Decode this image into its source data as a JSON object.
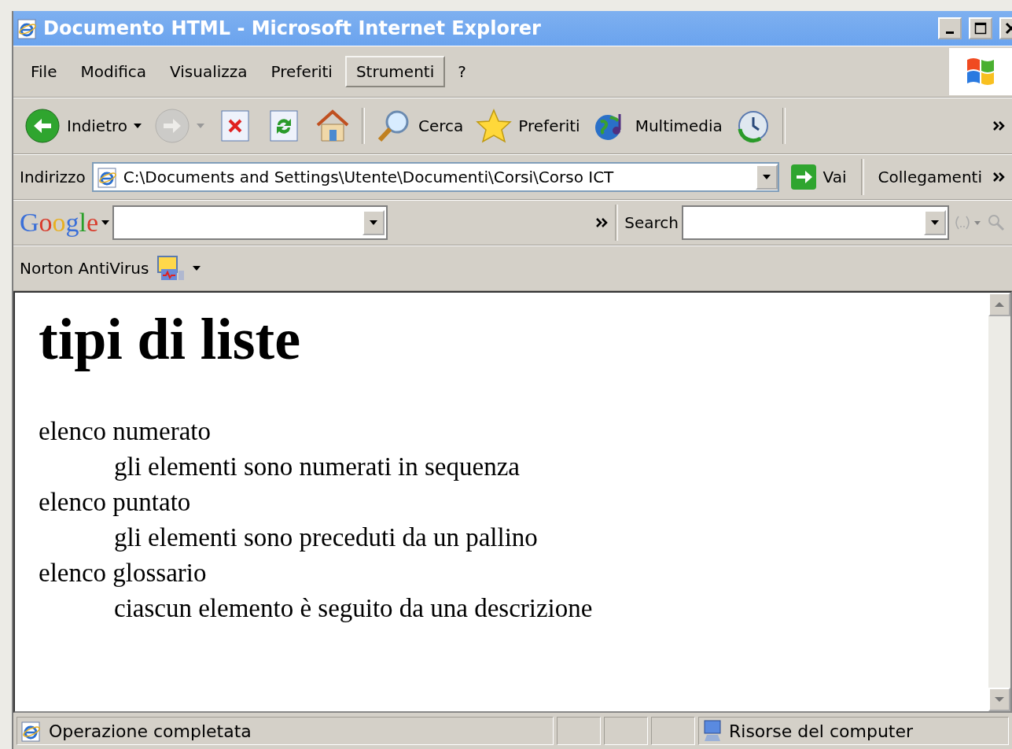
{
  "window": {
    "title": "Documento HTML - Microsoft Internet Explorer"
  },
  "menu": [
    {
      "label": "File",
      "selected": false
    },
    {
      "label": "Modifica",
      "selected": false
    },
    {
      "label": "Visualizza",
      "selected": false
    },
    {
      "label": "Preferiti",
      "selected": false
    },
    {
      "label": "Strumenti",
      "selected": true
    },
    {
      "label": "?",
      "selected": false
    }
  ],
  "toolbar": [
    {
      "kind": "back",
      "label": "Indietro",
      "dropdown": true,
      "disabled": false
    },
    {
      "kind": "forward",
      "dropdown": true,
      "disabled": true
    },
    {
      "kind": "stop",
      "dropdown": false,
      "disabled": false
    },
    {
      "kind": "refresh",
      "dropdown": false,
      "disabled": false
    },
    {
      "kind": "home",
      "dropdown": false,
      "disabled": false
    },
    {
      "kind": "search",
      "label": "Cerca",
      "dropdown": false,
      "disabled": false
    },
    {
      "kind": "favorites",
      "label": "Preferiti",
      "dropdown": false,
      "disabled": false
    },
    {
      "kind": "media",
      "label": "Multimedia",
      "dropdown": false,
      "disabled": false
    },
    {
      "kind": "history",
      "dropdown": false,
      "disabled": false
    }
  ],
  "address_bar": {
    "label": "Indirizzo",
    "value": "C:\\Documents and Settings\\Utente\\Documenti\\Corsi\\Corso ICT",
    "go": "Vai",
    "links": "Collegamenti"
  },
  "google_bar": {
    "logo": "Google",
    "search_label": "Search"
  },
  "norton_bar": {
    "label": "Norton AntiVirus"
  },
  "page": {
    "heading": "tipi di liste",
    "items": [
      {
        "term": "elenco numerato",
        "description": "gli elementi sono numerati in sequenza"
      },
      {
        "term": "elenco puntato",
        "description": "gli elementi sono preceduti da un pallino"
      },
      {
        "term": "elenco glossario",
        "description": "ciascun elemento è seguito da una descrizione"
      }
    ]
  },
  "status_bar": {
    "text": "Operazione completata",
    "zone": "Risorse del computer"
  }
}
